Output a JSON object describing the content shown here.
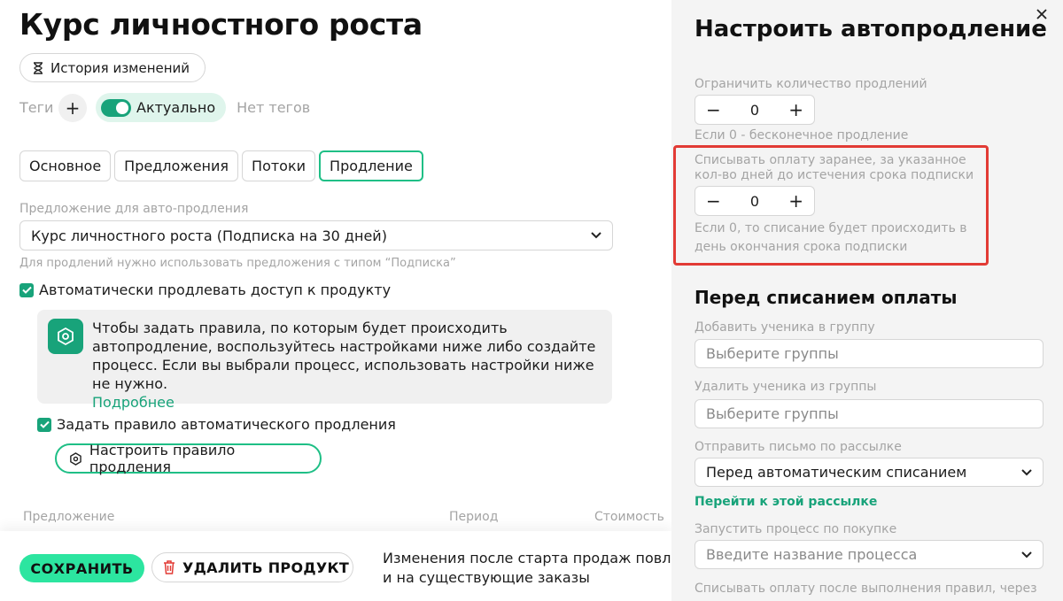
{
  "page": {
    "title": "Курс личностного роста",
    "history_button": "История изменений",
    "tags_label": "Теги",
    "actual_label": "Актуально",
    "no_tags": "Нет тегов"
  },
  "tabs": [
    {
      "label": "Основное"
    },
    {
      "label": "Предложения"
    },
    {
      "label": "Потоки"
    },
    {
      "label": "Продление",
      "active": true
    }
  ],
  "renewal": {
    "offer_label": "Предложение для авто-продления",
    "offer_value": "Курс личностного роста (Подписка на 30 дней)",
    "offer_hint": "Для продлений нужно использовать предложения с типом “Подписка”",
    "auto_renew_label": "Автоматически продлевать доступ к продукту",
    "info_text": "Чтобы задать правила, по которым будет происходить автопродление, воспользуйтесь настройками ниже либо создайте процесс. Если вы выбрали процесс, использовать настройки ниже не нужно.",
    "info_link": "Подробнее",
    "set_rule_label": "Задать правило автоматического продления",
    "rule_button": "Настроить правило продления",
    "columns": [
      "Предложение",
      "Период",
      "Стоимость"
    ]
  },
  "footer": {
    "save": "СОХРАНИТЬ",
    "delete": "УДАЛИТЬ ПРОДУКТ",
    "note_line1": "Изменения после старта продаж повлия",
    "note_line2": "и на существующие заказы"
  },
  "panel": {
    "title": "Настроить автопродление",
    "limit_label": "Ограничить количество продлений",
    "limit_value": "0",
    "limit_hint": "Если 0 - бесконечное продление",
    "advance_label_1": "Списывать оплату заранее, за указанное",
    "advance_label_2": "кол-во дней до истечения срока подписки",
    "advance_value": "0",
    "advance_hint_1": "Если 0, то списание будет происходить в",
    "advance_hint_2": "день окончания срока подписки",
    "section_title": "Перед списанием оплаты",
    "add_group_label": "Добавить ученика в группу",
    "add_group_placeholder": "Выберите группы",
    "remove_group_label": "Удалить ученика из группы",
    "remove_group_placeholder": "Выберите группы",
    "mail_label": "Отправить письмо по рассылке",
    "mail_value": "Перед автоматическим списанием",
    "mail_link": "Перейти к этой рассылке",
    "process_label": "Запустить процесс по покупке",
    "process_placeholder": "Введите название процесса",
    "after_rules_label": "Списывать оплату после выполнения правил, через"
  },
  "colors": {
    "accent": "#18a37a",
    "save_button": "#2ce5a0",
    "highlight": "#e23b35",
    "panel_bg": "#f4f4f4"
  }
}
